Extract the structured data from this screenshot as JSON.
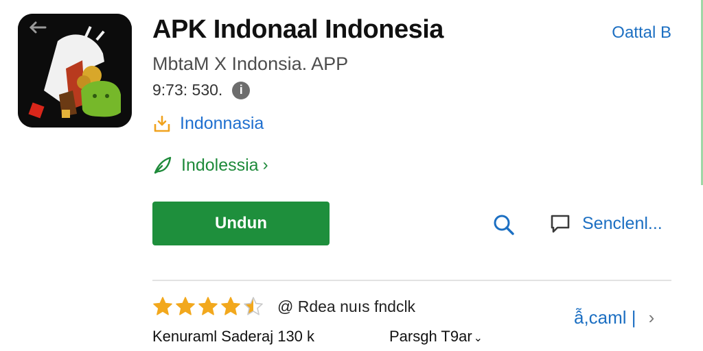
{
  "app": {
    "title": "APK Indonaal Indonesia",
    "subtitle": "MbtaM X Indonsia. APP",
    "meta": "9:73: 530.",
    "info_symbol": "i",
    "top_link": "Oattal B"
  },
  "links": {
    "download": "Indonnasia",
    "category": "Indolessia",
    "category_chevron": "›"
  },
  "actions": {
    "install_label": "Undun",
    "send_label": "Senclenl..."
  },
  "rating": {
    "value_stars": 4.5,
    "max_stars": 5,
    "text": "@ Rdea nuıs fndclk",
    "star_color": "#f2a81d",
    "empty_star_color": "#c9c9c9"
  },
  "stats": {
    "left": "Kenuraml Saderaj 130 k",
    "mid": "Parsgh T9ar",
    "mid_caret": "⌄"
  },
  "reviews": {
    "label": "ẫ,caml |",
    "chevron": "›"
  },
  "colors": {
    "accent_blue": "#1c6fc2",
    "install_green": "#1e8f3c",
    "category_green": "#1e8a3a",
    "download_orange": "#f0a21e"
  },
  "icons": {
    "back": "arrow-left-icon",
    "info": "info-icon",
    "download": "download-icon",
    "category": "leaf-icon",
    "search": "search-icon",
    "chat": "chat-bubble-icon",
    "star": "star-icon"
  }
}
